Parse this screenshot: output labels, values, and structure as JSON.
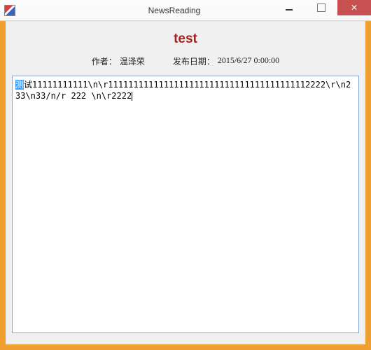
{
  "window": {
    "title": "NewsReading"
  },
  "article": {
    "title": "test",
    "author_label": "作者：",
    "author": "温泽荣",
    "date_label": "发布日期：",
    "date": "2015/6/27 0:00:00"
  },
  "content": {
    "selected": "测",
    "text": "试11111111111\\n\\r1111111111111111111111111111111111111112222\\r\\n233\\n33/n/r 222 \\n\\r2222"
  }
}
